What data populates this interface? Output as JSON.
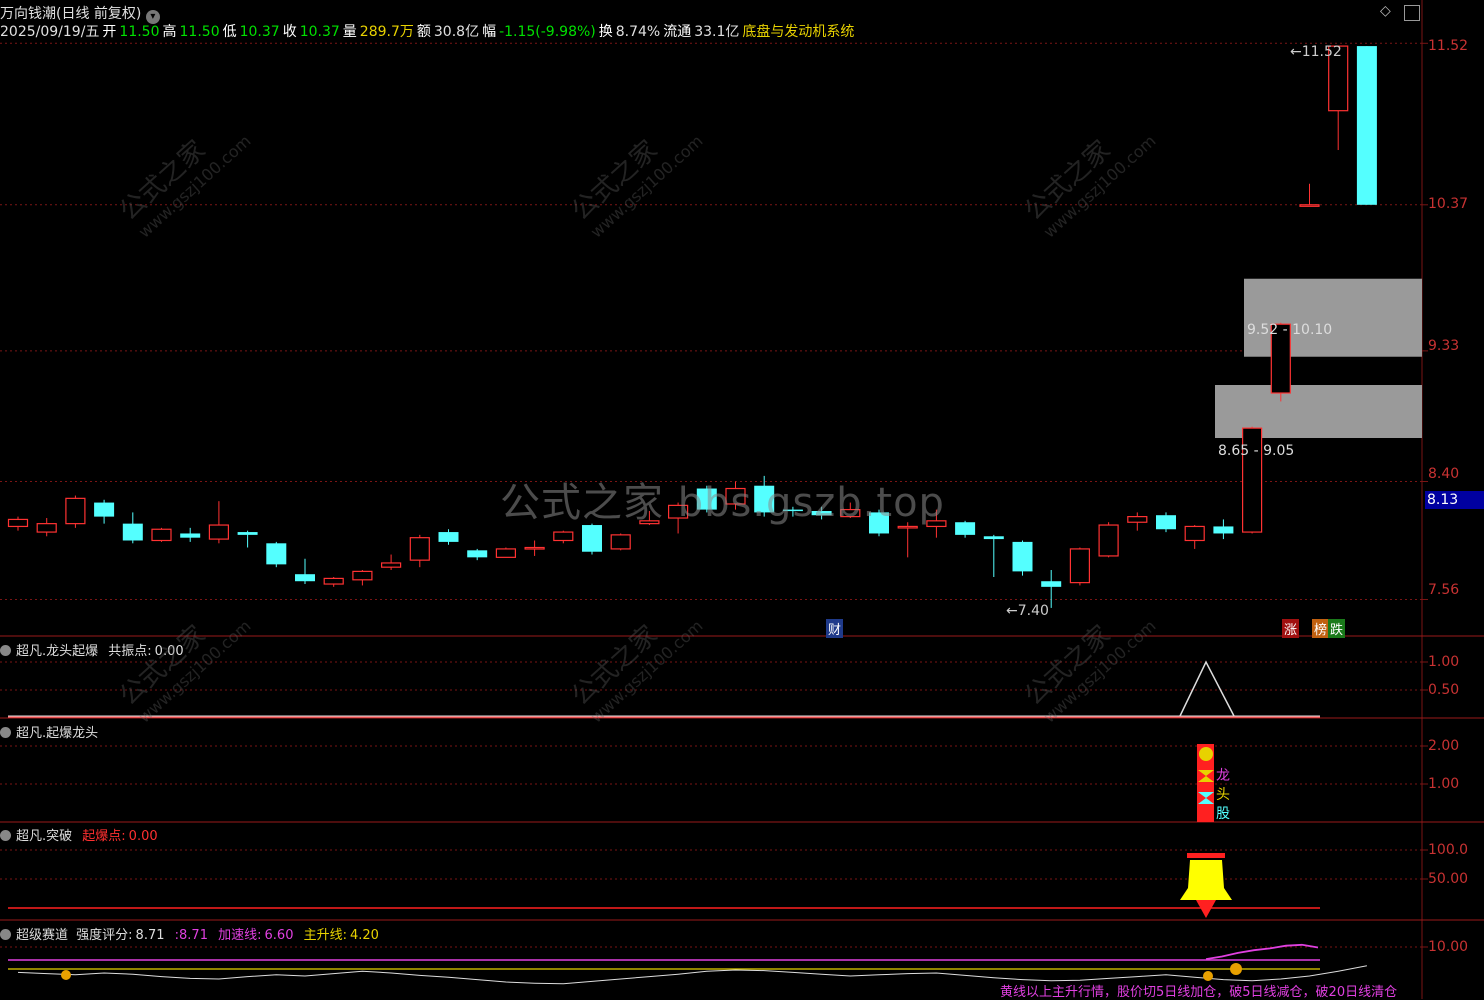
{
  "header": {
    "title": "万向钱潮(日线 前复权)",
    "title_icon": "chevron-down-icon"
  },
  "quote": {
    "date": "2025/09/19/五",
    "open_label": "开",
    "open": "11.50",
    "high_label": "高",
    "high": "11.50",
    "low_label": "低",
    "low": "10.37",
    "close_label": "收",
    "close": "10.37",
    "vol_label": "量",
    "vol": "289.7万",
    "amt_label": "额",
    "amt": "30.8亿",
    "chg_label": "幅",
    "chg": "-1.15(-9.98%)",
    "turn_label": "换",
    "turn": "8.74%",
    "float_label": "流通",
    "float": "33.1亿",
    "system": "底盘与发动机系统"
  },
  "axis": {
    "main": [
      "11.52",
      "10.37",
      "9.33",
      "8.40",
      "7.56"
    ],
    "current": "8.13",
    "p1": [
      "1.00",
      "0.50"
    ],
    "p2": [
      "2.00",
      "1.00"
    ],
    "p3": [
      "100.0",
      "50.00"
    ],
    "p4": [
      "10.00"
    ]
  },
  "annotations": {
    "high": "11.52",
    "low": "7.40",
    "zone1": "9.52 - 10.10",
    "zone2": "8.65 - 9.05",
    "cai": "财",
    "zhang": "涨",
    "bang": "榜",
    "die": "跌"
  },
  "panels": {
    "p1": {
      "name": "超凡.龙头起爆",
      "ind_label": "共振点:",
      "ind_val": "0.00"
    },
    "p2": {
      "name": "超凡.起爆龙头",
      "tags": [
        "龙",
        "头",
        "股"
      ]
    },
    "p3": {
      "name": "超凡.突破",
      "ind_label": "起爆点:",
      "ind_val": "0.00"
    },
    "p4": {
      "name": "超级赛道",
      "s1_label": "强度评分:",
      "s1": "8.71",
      "s2_label": ":",
      "s2": "8.71",
      "s3_label": "加速线:",
      "s3": "6.60",
      "s4_label": "主升线:",
      "s4": "4.20",
      "ticker": "黄线以上主升行情，股价切5日线加仓，破5日线减仓，破20日线清仓"
    }
  },
  "watermark": {
    "center": "公式之家 bbs.gszb.top",
    "diag": "公式之家",
    "diag_url": "www.gszj100.com"
  },
  "colors": {
    "up": "#ff3232",
    "down": "#54ffff",
    "grid": "#7a1515"
  },
  "chart_data": {
    "type": "candlestick",
    "ylim": [
      7.3,
      11.7
    ],
    "candles": [
      [
        8.08,
        8.13,
        8.05,
        8.15
      ],
      [
        8.04,
        8.1,
        8.01,
        8.14
      ],
      [
        8.1,
        8.28,
        8.07,
        8.3
      ],
      [
        8.25,
        8.15,
        8.1,
        8.27
      ],
      [
        8.1,
        7.98,
        7.96,
        8.18
      ],
      [
        7.98,
        8.06,
        7.97,
        8.07
      ],
      [
        8.03,
        8.0,
        7.97,
        8.07
      ],
      [
        7.99,
        8.09,
        7.96,
        8.26
      ],
      [
        8.04,
        8.02,
        7.93,
        8.05
      ],
      [
        7.96,
        7.81,
        7.79,
        7.97
      ],
      [
        7.74,
        7.69,
        7.67,
        7.85
      ],
      [
        7.67,
        7.71,
        7.65,
        7.72
      ],
      [
        7.7,
        7.76,
        7.66,
        7.77
      ],
      [
        7.79,
        7.82,
        7.77,
        7.88
      ],
      [
        7.84,
        8.0,
        7.79,
        8.02
      ],
      [
        8.04,
        7.97,
        7.95,
        8.06
      ],
      [
        7.91,
        7.86,
        7.84,
        7.92
      ],
      [
        7.86,
        7.92,
        7.86,
        7.93
      ],
      [
        7.93,
        7.93,
        7.87,
        7.98
      ],
      [
        7.98,
        8.04,
        7.96,
        8.05
      ],
      [
        8.09,
        7.9,
        7.88,
        8.1
      ],
      [
        7.92,
        8.02,
        7.91,
        8.03
      ],
      [
        8.1,
        8.12,
        8.09,
        8.19
      ],
      [
        8.14,
        8.23,
        8.03,
        8.25
      ],
      [
        8.35,
        8.2,
        8.18,
        8.37
      ],
      [
        8.24,
        8.35,
        8.2,
        8.4
      ],
      [
        8.37,
        8.18,
        8.15,
        8.44
      ],
      [
        8.2,
        8.19,
        8.15,
        8.22
      ],
      [
        8.19,
        8.16,
        8.13,
        8.22
      ],
      [
        8.15,
        8.2,
        8.14,
        8.25
      ],
      [
        8.18,
        8.03,
        8.01,
        8.2
      ],
      [
        8.08,
        8.08,
        7.86,
        8.11
      ],
      [
        8.08,
        8.12,
        8.0,
        8.2
      ],
      [
        8.11,
        8.02,
        8.0,
        8.12
      ],
      [
        8.01,
        7.99,
        7.72,
        8.02
      ],
      [
        7.97,
        7.76,
        7.73,
        7.98
      ],
      [
        7.69,
        7.65,
        7.5,
        7.77
      ],
      [
        7.68,
        7.92,
        7.66,
        7.93
      ],
      [
        7.87,
        8.09,
        7.86,
        8.11
      ],
      [
        8.11,
        8.15,
        8.05,
        8.18
      ],
      [
        8.16,
        8.06,
        8.04,
        8.18
      ],
      [
        7.98,
        8.08,
        7.92,
        8.09
      ],
      [
        8.08,
        8.03,
        7.99,
        8.13
      ],
      [
        8.04,
        8.78,
        8.03,
        8.79
      ],
      [
        9.03,
        9.52,
        8.97,
        9.53
      ],
      [
        10.36,
        10.37,
        10.37,
        10.52
      ],
      [
        11.04,
        11.5,
        10.76,
        11.5
      ],
      [
        11.5,
        10.37,
        10.37,
        11.5
      ]
    ],
    "zones": [
      [
        9.52,
        10.1
      ],
      [
        8.65,
        9.05
      ]
    ],
    "p1_peak": 1.0,
    "p4_white": [
      7.6,
      7.4,
      7.2,
      7.5,
      7.3,
      6.9,
      6.6,
      6.5,
      6.9,
      7.2,
      7.0,
      7.4,
      7.8,
      7.5,
      7.1,
      6.8,
      6.4,
      6.0,
      5.8,
      5.7,
      6.1,
      6.5,
      6.9,
      7.3,
      7.8,
      8.0,
      7.9,
      7.6,
      7.3,
      7.0,
      7.2,
      7.4,
      7.5,
      7.1,
      6.7,
      6.4,
      6.2,
      6.3,
      6.6,
      6.9,
      7.2,
      6.8,
      6.4,
      6.2,
      6.5,
      7.0,
      7.8,
      8.7
    ],
    "p4_magenta_tail": [
      8.71,
      9.0,
      9.4,
      9.7,
      9.9,
      10.2,
      10.3,
      10.0
    ]
  }
}
